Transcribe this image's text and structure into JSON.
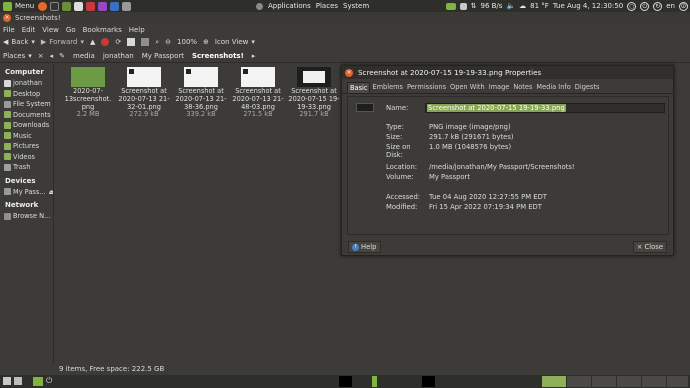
{
  "top_panel": {
    "menu_label": "Menu",
    "apps": [
      "Applications",
      "Places",
      "System"
    ],
    "net_speed": "96 B/s",
    "weather": "81 °F",
    "clock": "Tue Aug  4, 12:30:50",
    "lang": "en"
  },
  "window": {
    "title": "Screenshots!"
  },
  "menubar": [
    "File",
    "Edit",
    "View",
    "Go",
    "Bookmarks",
    "Help"
  ],
  "toolbar": {
    "back": "Back",
    "forward": "Forward",
    "zoom": "100%",
    "view_mode": "Icon View"
  },
  "locbar": {
    "places_label": "Places",
    "crumbs": [
      "media",
      "jonathan",
      "My Passport",
      "Screenshots!"
    ]
  },
  "sidebar": {
    "computer_label": "Computer",
    "computer_items": [
      "jonathan",
      "Desktop",
      "File System",
      "Documents",
      "Downloads",
      "Music",
      "Pictures",
      "Videos",
      "Trash"
    ],
    "devices_label": "Devices",
    "device_items": [
      "My Pass..."
    ],
    "network_label": "Network",
    "network_items": [
      "Browse N..."
    ]
  },
  "files": [
    {
      "name1": "2020-07-",
      "name2": "13screenshot.",
      "name3": "png",
      "size": "2.2 MB"
    },
    {
      "name1": "Screenshot at",
      "name2": "2020-07-13 21-",
      "name3": "32-01.png",
      "size": "272.9 kB"
    },
    {
      "name1": "Screenshot at",
      "name2": "2020-07-13 21-",
      "name3": "38-36.png",
      "size": "339.2 kB"
    },
    {
      "name1": "Screenshot at",
      "name2": "2020-07-13 21-",
      "name3": "48-03.png",
      "size": "271.5 kB"
    },
    {
      "name1": "Screenshot at",
      "name2": "2020-07-15 19-",
      "name3": "19-33.png",
      "size": "291.7 kB"
    }
  ],
  "status": "9 items, Free space: 222.5 GB",
  "dialog": {
    "title": "Screenshot at 2020-07-15 19-19-33.png Properties",
    "tabs": [
      "Basic",
      "Emblems",
      "Permissions",
      "Open With",
      "Image",
      "Notes",
      "Media Info",
      "Digests"
    ],
    "name_label": "Name:",
    "name_value": "Screenshot at 2020-07-15 19-19-33.png",
    "type_label": "Type:",
    "type_value": "PNG image (image/png)",
    "size_label": "Size:",
    "size_value": "291.7 kB (291671 bytes)",
    "disk_label": "Size on Disk:",
    "disk_value": "1.0 MB (1048576 bytes)",
    "location_label": "Location:",
    "location_value": "/media/jonathan/My Passport/Screenshots!",
    "volume_label": "Volume:",
    "volume_value": "My Passport",
    "accessed_label": "Accessed:",
    "accessed_value": "Tue 04 Aug 2020 12:27:55 PM EDT",
    "modified_label": "Modified:",
    "modified_value": "Fri 15 Apr 2022 07:19:34 PM EDT",
    "help_label": "Help",
    "close_label": "Close"
  }
}
